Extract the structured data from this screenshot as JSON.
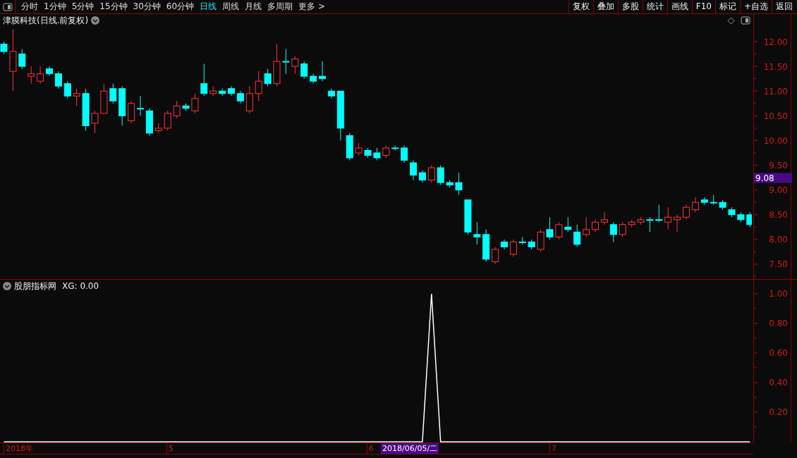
{
  "toolbar": {
    "periods": [
      {
        "label": "分时",
        "selected": false
      },
      {
        "label": "1分钟",
        "selected": false
      },
      {
        "label": "5分钟",
        "selected": false
      },
      {
        "label": "15分钟",
        "selected": false
      },
      {
        "label": "30分钟",
        "selected": false
      },
      {
        "label": "60分钟",
        "selected": false
      },
      {
        "label": "日线",
        "selected": true
      },
      {
        "label": "周线",
        "selected": false
      },
      {
        "label": "月线",
        "selected": false
      },
      {
        "label": "多周期",
        "selected": false
      },
      {
        "label": "更多 >",
        "selected": false
      }
    ],
    "buttons": [
      "复权",
      "叠加",
      "多股",
      "统计",
      "画线",
      "F10",
      "标记",
      "+自选",
      "返回"
    ]
  },
  "main_chart": {
    "title": "津膜科技(日线.前复权)",
    "current_price": "9.08",
    "chart_data": {
      "type": "candlestick",
      "categories": [
        null,
        null,
        null,
        null,
        null,
        null,
        null,
        null,
        null,
        null,
        null,
        null,
        null,
        null,
        null,
        null,
        null,
        null,
        null,
        null,
        null,
        null,
        null,
        null,
        null,
        null,
        null,
        null,
        null,
        null,
        null,
        null,
        null,
        null,
        null,
        null,
        null,
        null,
        null,
        null,
        null,
        null,
        null,
        null,
        null,
        null,
        null,
        null,
        null,
        null,
        null,
        null,
        null,
        null,
        null,
        null,
        null,
        null,
        null,
        null,
        null,
        null,
        null,
        null,
        null,
        null,
        null,
        null,
        null,
        null,
        null,
        null,
        null,
        null,
        null,
        null,
        null,
        null,
        null,
        null,
        null,
        null,
        null
      ],
      "ylim": [
        7.2,
        12.556
      ],
      "yticks": [
        {
          "value": 12,
          "label": "12.00"
        },
        {
          "value": 11.5,
          "label": "11.50"
        },
        {
          "value": 11,
          "label": "11.00"
        },
        {
          "value": 10.5,
          "label": "10.50"
        },
        {
          "value": 10,
          "label": "10.00"
        },
        {
          "value": 9.5,
          "label": "9.50"
        },
        {
          "value": 9,
          "label": "9.00"
        },
        {
          "value": 8.5,
          "label": "8.50"
        },
        {
          "value": 8,
          "label": "8.00"
        },
        {
          "value": 7.5,
          "label": "7.50"
        }
      ],
      "ohlc": [
        [
          11.95,
          12.0,
          11.75,
          11.8
        ],
        [
          11.4,
          12.25,
          11.0,
          11.8
        ],
        [
          11.75,
          11.85,
          11.45,
          11.5
        ],
        [
          11.3,
          11.5,
          11.15,
          11.35
        ],
        [
          11.2,
          11.5,
          11.15,
          11.35
        ],
        [
          11.45,
          11.5,
          11.3,
          11.35
        ],
        [
          11.35,
          11.4,
          11.05,
          11.1
        ],
        [
          11.15,
          11.2,
          10.85,
          10.9
        ],
        [
          10.9,
          11.05,
          10.7,
          10.95
        ],
        [
          10.95,
          11.05,
          10.2,
          10.3
        ],
        [
          10.35,
          10.6,
          10.15,
          10.55
        ],
        [
          10.55,
          11.15,
          10.55,
          11.0
        ],
        [
          11.05,
          11.15,
          10.75,
          10.8
        ],
        [
          11.05,
          11.1,
          10.3,
          10.5
        ],
        [
          10.4,
          10.8,
          10.35,
          10.75
        ],
        [
          10.65,
          10.9,
          10.5,
          10.65
        ],
        [
          10.6,
          10.65,
          10.1,
          10.15
        ],
        [
          10.2,
          10.35,
          10.15,
          10.25
        ],
        [
          10.25,
          10.6,
          10.2,
          10.55
        ],
        [
          10.5,
          10.8,
          10.45,
          10.7
        ],
        [
          10.7,
          10.75,
          10.6,
          10.65
        ],
        [
          10.6,
          10.95,
          10.55,
          10.85
        ],
        [
          11.15,
          11.55,
          10.9,
          10.95
        ],
        [
          10.95,
          11.1,
          10.9,
          11.0
        ],
        [
          11.0,
          11.05,
          10.9,
          10.95
        ],
        [
          11.05,
          11.1,
          10.9,
          10.95
        ],
        [
          10.95,
          11.0,
          10.75,
          10.8
        ],
        [
          10.6,
          11.1,
          10.55,
          10.95
        ],
        [
          10.95,
          11.4,
          10.8,
          11.2
        ],
        [
          11.35,
          11.45,
          11.1,
          11.15
        ],
        [
          11.15,
          11.95,
          11.1,
          11.6
        ],
        [
          11.6,
          11.85,
          11.35,
          11.6
        ],
        [
          11.5,
          11.7,
          11.35,
          11.65
        ],
        [
          11.55,
          11.6,
          11.25,
          11.3
        ],
        [
          11.3,
          11.35,
          11.15,
          11.2
        ],
        [
          11.3,
          11.6,
          11.2,
          11.25
        ],
        [
          11.0,
          11.05,
          10.85,
          10.9
        ],
        [
          11.0,
          11.0,
          10.0,
          10.25
        ],
        [
          10.1,
          10.15,
          9.6,
          9.65
        ],
        [
          9.75,
          9.95,
          9.7,
          9.85
        ],
        [
          9.8,
          9.85,
          9.65,
          9.7
        ],
        [
          9.75,
          9.85,
          9.6,
          9.65
        ],
        [
          9.7,
          9.9,
          9.65,
          9.85
        ],
        [
          9.85,
          9.9,
          9.8,
          9.85
        ],
        [
          9.85,
          9.9,
          9.55,
          9.6
        ],
        [
          9.55,
          9.6,
          9.2,
          9.3
        ],
        [
          9.35,
          9.4,
          9.15,
          9.2
        ],
        [
          9.2,
          9.5,
          9.15,
          9.45
        ],
        [
          9.45,
          9.5,
          9.1,
          9.15
        ],
        [
          9.15,
          9.2,
          9.05,
          9.1
        ],
        [
          9.15,
          9.35,
          8.9,
          9.0
        ],
        [
          8.8,
          8.8,
          8.1,
          8.15
        ],
        [
          8.1,
          8.35,
          7.9,
          8.05
        ],
        [
          8.1,
          8.2,
          7.55,
          7.6
        ],
        [
          7.55,
          7.85,
          7.5,
          7.8
        ],
        [
          7.95,
          8.0,
          7.8,
          7.85
        ],
        [
          7.7,
          8.0,
          7.65,
          7.95
        ],
        [
          7.95,
          8.05,
          7.9,
          7.95
        ],
        [
          7.95,
          8.0,
          7.8,
          7.85
        ],
        [
          7.8,
          8.2,
          7.75,
          8.15
        ],
        [
          8.2,
          8.45,
          8.0,
          8.05
        ],
        [
          8.05,
          8.35,
          8.0,
          8.3
        ],
        [
          8.25,
          8.45,
          8.15,
          8.2
        ],
        [
          8.15,
          8.3,
          7.85,
          7.9
        ],
        [
          8.1,
          8.45,
          8.05,
          8.2
        ],
        [
          8.2,
          8.4,
          8.15,
          8.35
        ],
        [
          8.35,
          8.55,
          8.3,
          8.4
        ],
        [
          8.3,
          8.35,
          7.95,
          8.1
        ],
        [
          8.1,
          8.35,
          8.05,
          8.3
        ],
        [
          8.3,
          8.4,
          8.25,
          8.35
        ],
        [
          8.35,
          8.45,
          8.3,
          8.4
        ],
        [
          8.4,
          8.45,
          8.15,
          8.4
        ],
        [
          8.4,
          8.7,
          8.35,
          8.4
        ],
        [
          8.35,
          8.65,
          8.2,
          8.45
        ],
        [
          8.4,
          8.5,
          8.15,
          8.45
        ],
        [
          8.45,
          8.7,
          8.4,
          8.65
        ],
        [
          8.6,
          8.85,
          8.55,
          8.75
        ],
        [
          8.8,
          8.85,
          8.7,
          8.75
        ],
        [
          8.75,
          8.9,
          8.7,
          8.75
        ],
        [
          8.75,
          8.8,
          8.6,
          8.65
        ],
        [
          8.6,
          8.65,
          8.45,
          8.5
        ],
        [
          8.5,
          8.55,
          8.35,
          8.4
        ],
        [
          8.5,
          8.55,
          8.25,
          8.3
        ]
      ]
    }
  },
  "indicator": {
    "name": "股朋指标网",
    "reading": ": 0.00",
    "chart_data": {
      "type": "line",
      "categories": [
        null,
        null,
        null,
        null,
        null,
        null,
        null,
        null,
        null,
        null,
        null,
        null,
        null,
        null,
        null,
        null,
        null,
        null,
        null,
        null,
        null,
        null,
        null,
        null,
        null,
        null,
        null,
        null,
        null,
        null,
        null,
        null,
        null,
        null,
        null,
        null,
        null,
        null,
        null,
        null,
        null,
        null,
        null,
        null,
        null,
        null,
        null,
        null,
        null,
        null,
        null,
        null,
        null,
        null,
        null,
        null,
        null,
        null,
        null,
        null,
        null,
        null,
        null,
        null,
        null,
        null,
        null,
        null,
        null,
        null,
        null,
        null,
        null,
        null,
        null,
        null,
        null,
        null,
        null,
        null,
        null,
        null,
        null
      ],
      "ylim": [
        -0.005,
        1.095
      ],
      "yticks": [
        {
          "value": 0.2,
          "label": "0.20"
        },
        {
          "value": 0.4,
          "label": "0.40"
        },
        {
          "value": 0.6,
          "label": "0.60"
        },
        {
          "value": 0.8,
          "label": "0.80"
        },
        {
          "value": 1.0,
          "label": "1.00"
        }
      ],
      "series": [
        {
          "name": "XG",
          "color": "#ffffff",
          "values": [
            0,
            0,
            0,
            0,
            0,
            0,
            0,
            0,
            0,
            0,
            0,
            0,
            0,
            0,
            0,
            0,
            0,
            0,
            0,
            0,
            0,
            0,
            0,
            0,
            0,
            0,
            0,
            0,
            0,
            0,
            0,
            0,
            0,
            0,
            0,
            0,
            0,
            0,
            0,
            0,
            0,
            0,
            0,
            0,
            0,
            0,
            0,
            1,
            0,
            0,
            0,
            0,
            0,
            0,
            0,
            0,
            0,
            0,
            0,
            0,
            0,
            0,
            0,
            0,
            0,
            0,
            0,
            0,
            0,
            0,
            0,
            0,
            0,
            0,
            0,
            0,
            0,
            0,
            0,
            0,
            0,
            0,
            0
          ]
        }
      ]
    }
  },
  "date_axis": [
    {
      "label": "2018年",
      "selected": false
    },
    {
      "label": "5",
      "selected": false
    },
    {
      "label": "6",
      "selected": false
    },
    {
      "label": "2018/06/05/二",
      "selected": true
    },
    {
      "label": "7",
      "selected": false
    }
  ]
}
